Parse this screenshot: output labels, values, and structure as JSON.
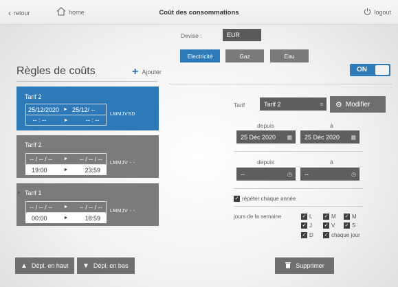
{
  "topbar": {
    "back_label": "retour",
    "home_label": "home",
    "title": "Coût des consommations",
    "logout_label": "logout"
  },
  "left": {
    "heading": "Règles de coûts",
    "add_label": "Ajouter",
    "cards": [
      {
        "name": "Tarif 2",
        "date_from": "25/12/2020",
        "date_to": "25/12/ --",
        "time_from": "-- : --",
        "time_to": "-- : --",
        "days": "LMMJVSD"
      },
      {
        "name": "Tarif 2",
        "date_from": "-- / -- / --",
        "date_to": "-- / -- / --",
        "time_from": "19:00",
        "time_to": "23:59",
        "days": "LMMJV - -"
      },
      {
        "name": "Tarif 1",
        "date_from": "-- / -- / --",
        "date_to": "-- / -- / --",
        "time_from": "00:00",
        "time_to": "18:59",
        "days": "LMMJV - -"
      }
    ],
    "move_up_label": "Dépl. en haut",
    "move_down_label": "Dépl. en bas"
  },
  "right": {
    "devise_label": "Devise :",
    "devise_value": "EUR",
    "energy_tabs": [
      "Electricité",
      "Gaz",
      "Eau"
    ],
    "toggle_label": "ON",
    "tarif_label": "Tarif",
    "tarif_value": "Tarif 2",
    "modify_label": "Modifier",
    "since_label": "depuis",
    "to_label": "à",
    "date_from": "25 Déc 2020",
    "date_to": "25 Déc 2020",
    "time_from": "--",
    "time_to": "--",
    "repeat_label": "répéter chaque année",
    "weekdays_label": "jours de la semaine",
    "days": [
      "L",
      "M",
      "M",
      "J",
      "V",
      "S",
      "D"
    ],
    "every_day_label": "chaque jour",
    "delete_label": "Supprimer"
  },
  "colors": {
    "accent": "#2e7ab8",
    "dark_field": "#5e5e5e",
    "card_grey": "#7b7b7b"
  }
}
